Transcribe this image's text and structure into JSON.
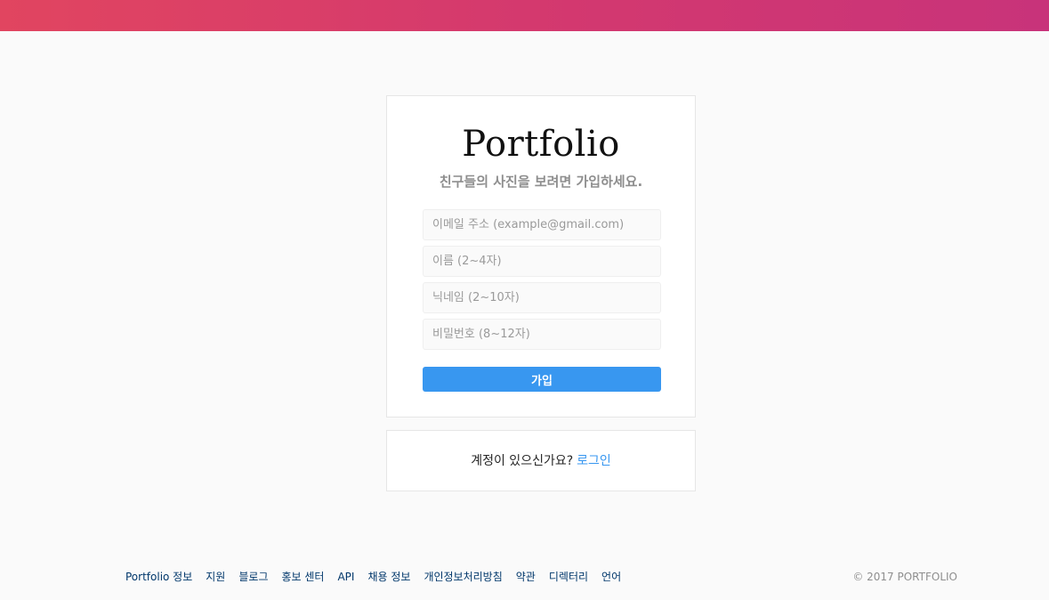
{
  "header": {
    "gradient_start": "#e14560",
    "gradient_end": "#c8337a"
  },
  "signup": {
    "logo": "Portfolio",
    "subtitle": "친구들의 사진을 보려면 가입하세요.",
    "email_placeholder": "이메일 주소 (example@gmail.com)",
    "name_placeholder": "이름 (2~4자)",
    "nickname_placeholder": "닉네임 (2~10자)",
    "password_placeholder": "비밀번호 (8~12자)",
    "submit_label": "가입",
    "button_color": "#3897f0"
  },
  "login": {
    "prompt": "계정이 있으신가요?",
    "link_label": "로그인"
  },
  "footer": {
    "links": [
      "Portfolio 정보",
      "지원",
      "블로그",
      "홍보 센터",
      "API",
      "채용 정보",
      "개인정보처리방침",
      "약관",
      "디렉터리",
      "언어"
    ],
    "copyright": "© 2017 PORTFOLIO"
  }
}
